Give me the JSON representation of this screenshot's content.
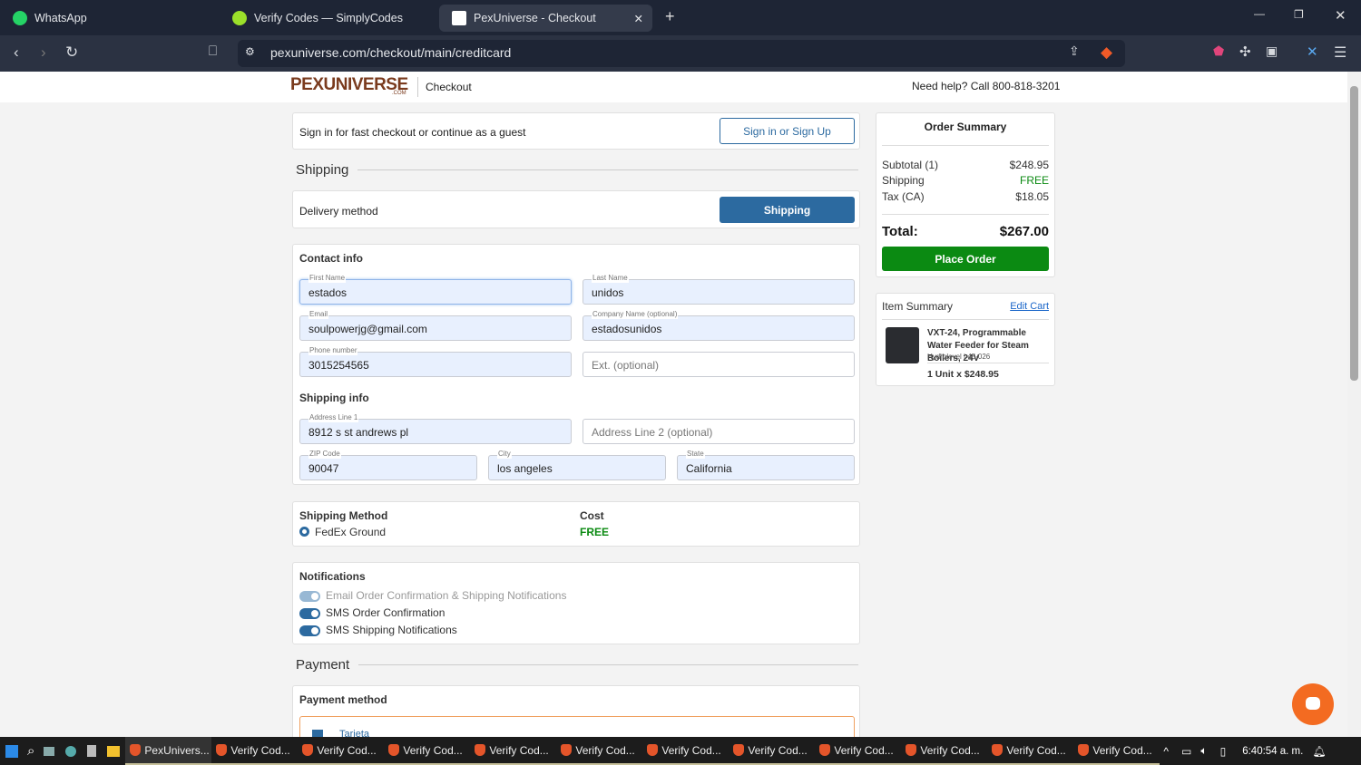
{
  "browser": {
    "tabs": [
      {
        "label": "WhatsApp"
      },
      {
        "label": "Verify Codes — SimplyCodes"
      },
      {
        "label": "PexUniverse - Checkout",
        "active": true
      }
    ],
    "url": "pexuniverse.com/checkout/main/creditcard"
  },
  "header": {
    "logo": "PEXUNIVERSE",
    "logo_sub": ".COM",
    "section": "Checkout",
    "help": "Need help? Call 800-818-3201"
  },
  "signin": {
    "text": "Sign in for fast checkout or continue as a guest",
    "button": "Sign in or Sign Up"
  },
  "shipping": {
    "heading": "Shipping",
    "delivery_label": "Delivery method",
    "delivery_button": "Shipping"
  },
  "contact": {
    "heading": "Contact info",
    "first_name": {
      "label": "First Name",
      "value": "estados"
    },
    "last_name": {
      "label": "Last Name",
      "value": "unidos"
    },
    "email": {
      "label": "Email",
      "value": "soulpowerjg@gmail.com"
    },
    "company": {
      "label": "Company Name (optional)",
      "value": "estadosunidos"
    },
    "phone": {
      "label": "Phone number",
      "value": "3015254565"
    },
    "ext": {
      "placeholder": "Ext. (optional)"
    }
  },
  "shipping_info": {
    "heading": "Shipping info",
    "address1": {
      "label": "Address Line 1",
      "value": "8912 s st andrews pl"
    },
    "address2": {
      "placeholder": "Address Line 2 (optional)"
    },
    "zip": {
      "label": "ZIP Code",
      "value": "90047"
    },
    "city": {
      "label": "City",
      "value": "los angeles"
    },
    "state": {
      "label": "State",
      "value": "California"
    }
  },
  "shipping_method": {
    "heading": "Shipping Method",
    "cost_heading": "Cost",
    "option": "FedEx Ground",
    "cost": "FREE"
  },
  "notifications": {
    "heading": "Notifications",
    "items": [
      {
        "label": "Email Order Confirmation & Shipping Notifications",
        "disabled": true
      },
      {
        "label": "SMS Order Confirmation"
      },
      {
        "label": "SMS Shipping Notifications"
      }
    ]
  },
  "payment": {
    "heading": "Payment",
    "method_heading": "Payment method",
    "option": "Tarjeta"
  },
  "order_summary": {
    "title": "Order Summary",
    "subtotal_label": "Subtotal (1)",
    "subtotal": "$248.95",
    "shipping_label": "Shipping",
    "shipping": "FREE",
    "tax_label": "Tax (CA)",
    "tax": "$18.05",
    "total_label": "Total:",
    "total": "$267.00",
    "place_order": "Place Order"
  },
  "item_summary": {
    "title": "Item Summary",
    "edit": "Edit Cart",
    "name": "VXT-24, Programmable Water Feeder for Steam Boilers, 24V",
    "brand": "Hydrolevel | 45-026",
    "qty": "1 Unit x $248.95"
  },
  "taskbar": {
    "items": [
      "PexUnivers...",
      "Verify Cod...",
      "Verify Cod...",
      "Verify Cod...",
      "Verify Cod...",
      "Verify Cod...",
      "Verify Cod...",
      "Verify Cod...",
      "Verify Cod...",
      "Verify Cod...",
      "Verify Cod...",
      "Verify Cod..."
    ],
    "time": "6:40:54 a. m."
  },
  "colors": {
    "accent": "#2c6aa0",
    "green": "#0b8a12",
    "brand": "#7a3b1e"
  }
}
